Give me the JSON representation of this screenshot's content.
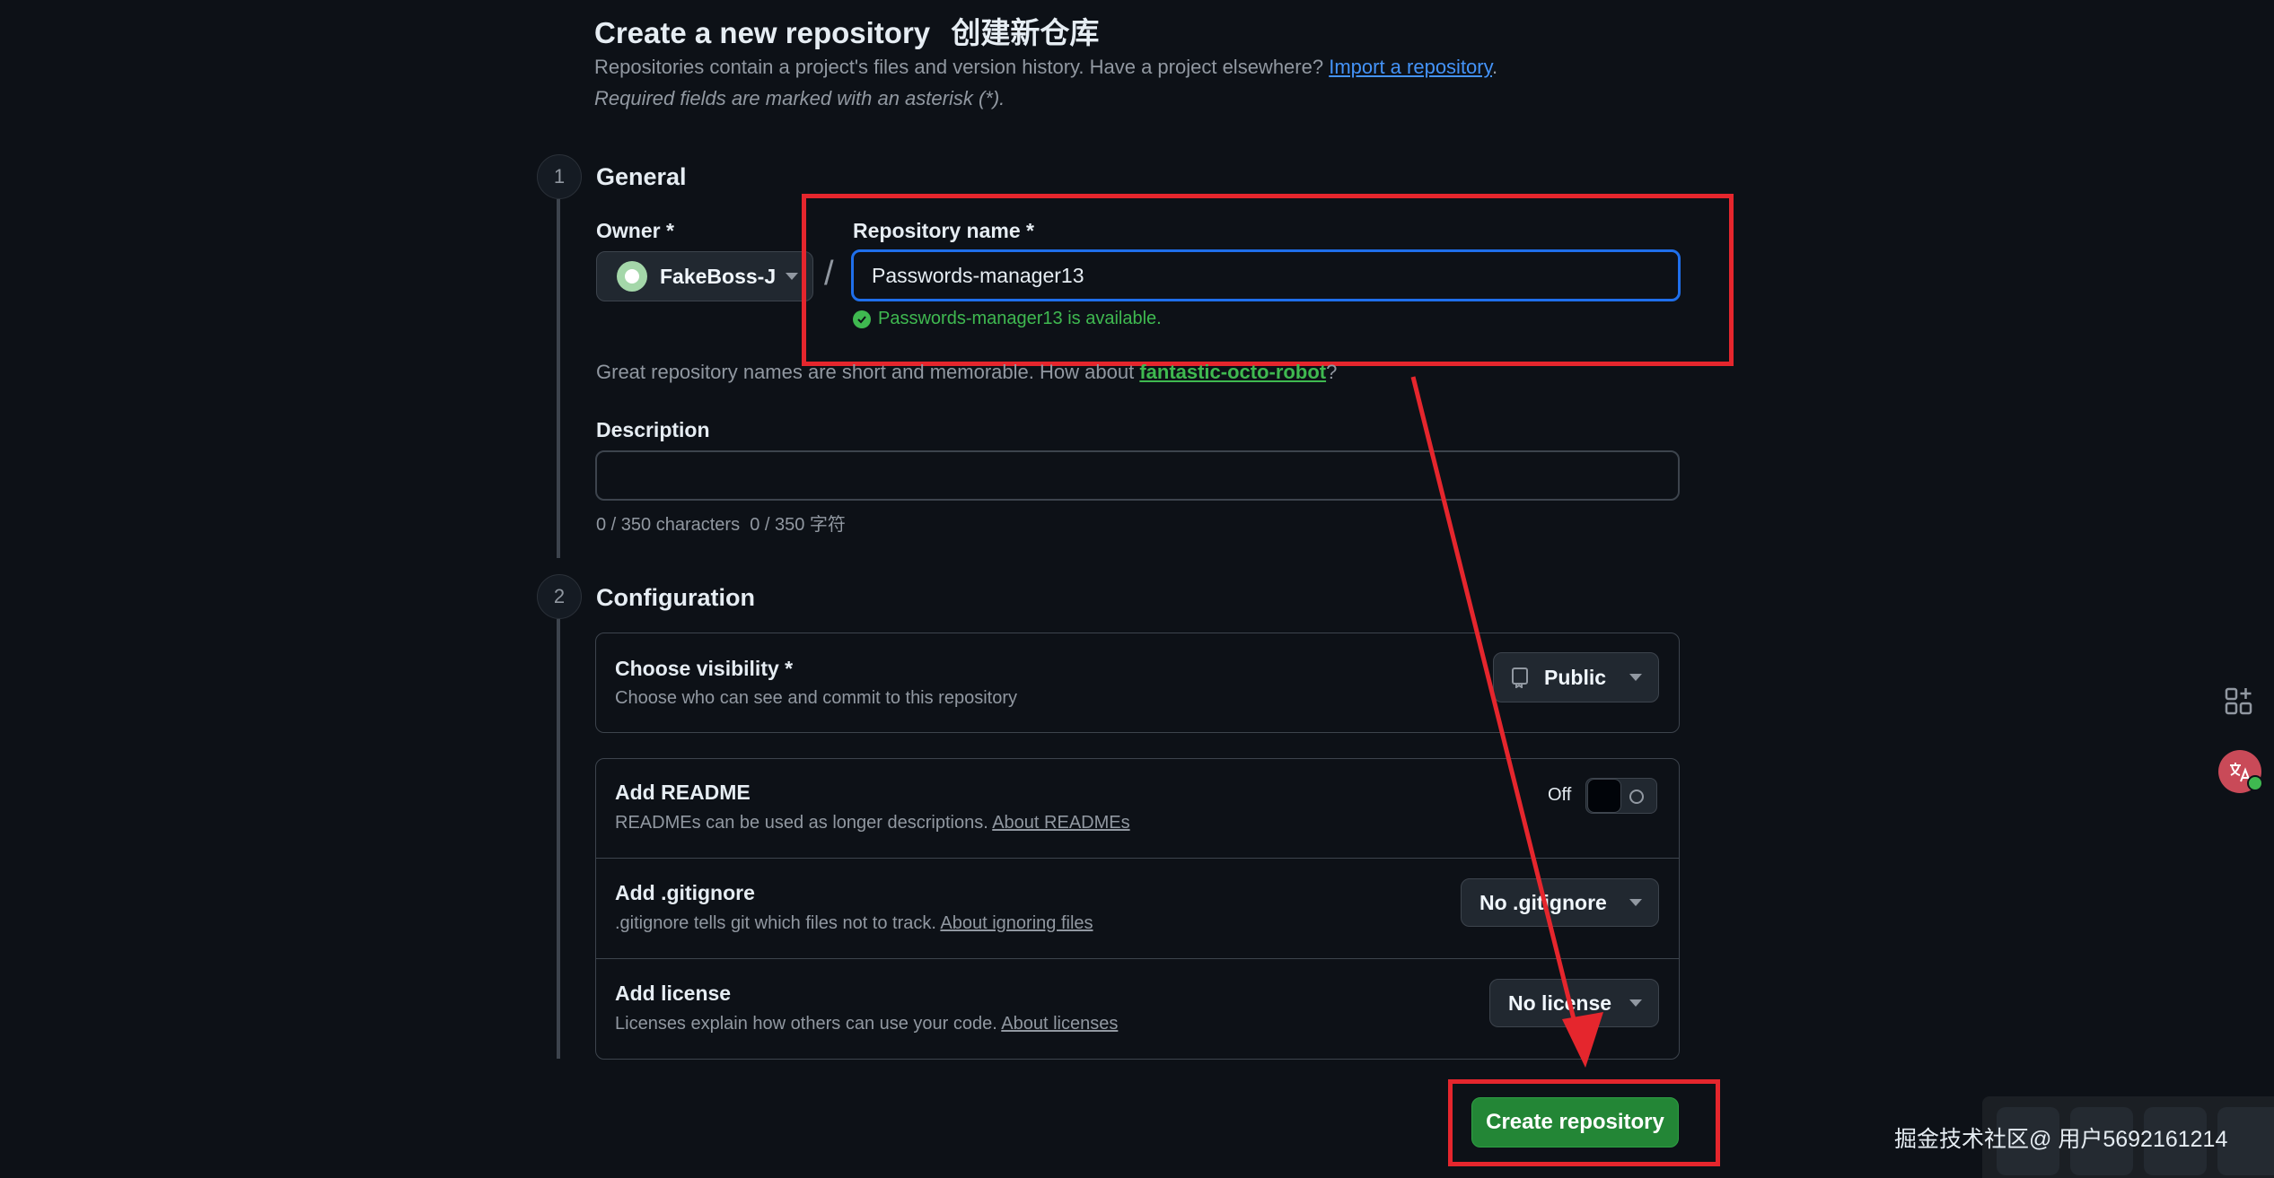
{
  "header": {
    "title": "Create a new repository",
    "title_cn": "创建新仓库",
    "subtitle_prefix": "Repositories contain a project's files and version history. Have a project elsewhere?",
    "import_link": "Import a repository",
    "subtitle_suffix": ".",
    "required_note": "Required fields are marked with an asterisk (*)."
  },
  "general": {
    "step_number": "1",
    "title": "General",
    "owner_label": "Owner *",
    "owner_value": "FakeBoss-J",
    "slash": "/",
    "repo_name_label": "Repository name *",
    "repo_name_value": "Passwords-manager13",
    "availability": "Passwords-manager13 is available.",
    "suggestion_prefix": "Great repository names are short and memorable. How about",
    "suggestion_link": "fantastic-octo-robot",
    "suggestion_suffix": "?",
    "description_label": "Description",
    "description_value": "",
    "char_count": "0 / 350 characters  0 / 350 字符"
  },
  "configuration": {
    "step_number": "2",
    "title": "Configuration",
    "visibility": {
      "title": "Choose visibility *",
      "desc": "Choose who can see and commit to this repository",
      "button": "Public"
    },
    "readme": {
      "title": "Add README",
      "desc": "READMEs can be used as longer descriptions.",
      "link": "About READMEs",
      "toggle_label": "Off"
    },
    "gitignore": {
      "title": "Add .gitignore",
      "desc": ".gitignore tells git which files not to track.",
      "link": "About ignoring files",
      "button": "No .gitignore"
    },
    "license": {
      "title": "Add license",
      "desc": "Licenses explain how others can use your code.",
      "link": "About licenses",
      "button": "No license"
    }
  },
  "actions": {
    "create_button": "Create repository"
  },
  "watermark": "掘金技术社区@ 用户5692161214",
  "colors": {
    "background": "#0d1117",
    "accent_blue": "#1f6feb",
    "success_green": "#3fb950",
    "create_green": "#238636",
    "annotation_red": "#e5262d"
  }
}
